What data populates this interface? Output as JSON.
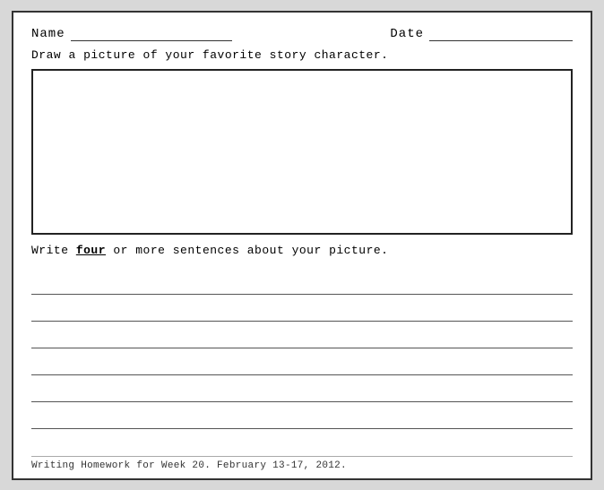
{
  "header": {
    "name_label": "Name",
    "date_label": "Date"
  },
  "instructions": {
    "draw_instruction": "Draw a picture of your favorite story character.",
    "write_instruction_prefix": "Write ",
    "write_instruction_underline": "four",
    "write_instruction_suffix": " or more sentences about your picture."
  },
  "footer": {
    "text": "Writing Homework for Week 20.  February 13-17, 2012."
  },
  "lines_count": 6
}
